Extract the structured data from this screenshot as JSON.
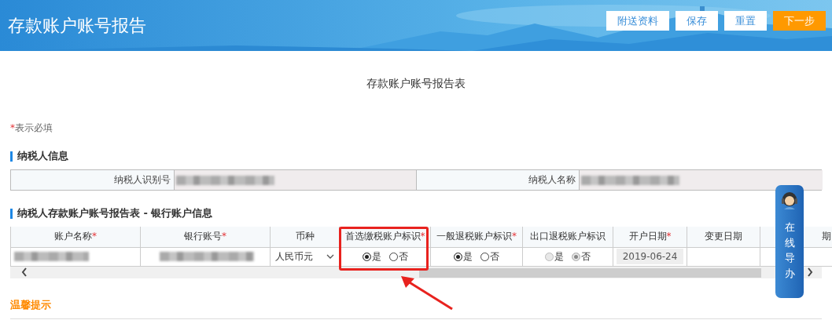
{
  "header": {
    "title": "存款账户账号报告",
    "buttons": [
      {
        "label": "附送资料",
        "kind": "normal"
      },
      {
        "label": "保存",
        "kind": "normal"
      },
      {
        "label": "重置",
        "kind": "normal"
      },
      {
        "label": "下一步",
        "kind": "primary"
      }
    ]
  },
  "form_title": "存款账户账号报告表",
  "required_note": {
    "mark": "*",
    "text": "表示必填"
  },
  "taxpayer_section": {
    "title": "纳税人信息",
    "fields": [
      {
        "label": "纳税人识别号"
      },
      {
        "label": "纳税人名称"
      }
    ]
  },
  "account_section": {
    "title": "纳税人存款账户账号报告表 - 银行账户信息",
    "columns": [
      {
        "label": "账户名称",
        "required": true
      },
      {
        "label": "银行账号",
        "required": true
      },
      {
        "label": "币种",
        "required": false
      },
      {
        "label": "首选缴税账户标识",
        "required": true
      },
      {
        "label": "一般退税账户标识",
        "required": true
      },
      {
        "label": "出口退税账户标识",
        "required": false
      },
      {
        "label": "开户日期",
        "required": true
      },
      {
        "label": "变更日期",
        "required": false
      },
      {
        "label": "期",
        "required": false
      }
    ],
    "rows": [
      {
        "currency": "人民币元",
        "preferred_tax": {
          "disabled": false,
          "options": [
            {
              "label": "是",
              "selected": true
            },
            {
              "label": "否",
              "selected": false
            }
          ]
        },
        "general_refund": {
          "disabled": false,
          "options": [
            {
              "label": "是",
              "selected": true
            },
            {
              "label": "否",
              "selected": false
            }
          ]
        },
        "export_refund": {
          "disabled": true,
          "options": [
            {
              "label": "是",
              "selected": false
            },
            {
              "label": "否",
              "selected": true
            }
          ]
        },
        "open_date": "2019-06-24"
      }
    ]
  },
  "tips_title": "温馨提示",
  "guide_button": {
    "label": "在线导办"
  }
}
